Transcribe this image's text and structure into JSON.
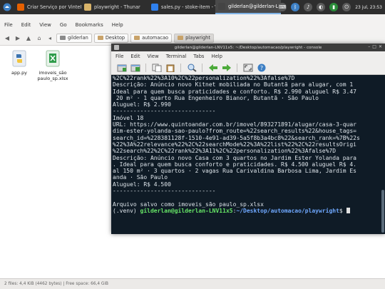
{
  "panel": {
    "tasks": [
      {
        "label": "Criar Serviço por VintePi...",
        "icon": "firefox-icon",
        "color": "#e66000"
      },
      {
        "label": "playwright - Thunar",
        "icon": "folder-icon",
        "color": "#d9b46a"
      },
      {
        "label": "sales.py - stoke-item - VS...",
        "icon": "vscode-icon",
        "color": "#2f80ed"
      },
      {
        "label": "gilderlan@gilderlan-LNV...",
        "icon": "terminal-icon",
        "color": "#444444"
      }
    ],
    "clock": "23 jul, 23:53"
  },
  "file_manager": {
    "menu": [
      "File",
      "Edit",
      "View",
      "Go",
      "Bookmarks",
      "Help"
    ],
    "breadcrumbs": [
      "gilderlan",
      "Desktop",
      "automacao",
      "playwright"
    ],
    "files": [
      {
        "name": "app.py",
        "icon": "python-file-icon"
      },
      {
        "name": "imoveis_são\npaulo_sp.xlsx",
        "icon": "spreadsheet-file-icon"
      }
    ],
    "status": "2 files: 4,4 KiB (4462 bytes) | Free space: 66,4 GiB"
  },
  "terminal": {
    "title": "gilderlan@gilderlan-LNV11x5: ~/Desktop/automacao/playwright - console",
    "menu": [
      "File",
      "Edit",
      "View",
      "Terminal",
      "Tabs",
      "Help"
    ],
    "lines": [
      "%2C%22rank%22%3A10%2C%22personalization%22%3Afalse%7D",
      "Descrição: Anúncio novo Kitnet mobiliada no Butantã para alugar, com 1",
      "Ideal para quem busca praticidades e conforto. R$ 2.990 aluguel R$ 3.47",
      " 20 m² · 1 quarto Rua Engenheiro Bianor, Butantã · São Paulo",
      "Aluguel: R$ 2.990",
      "------------------------------",
      "Imóvel 18",
      "URL: https://www.quintoandar.com.br/imovel/893271891/alugar/casa-3-quar",
      "dim-ester-yolanda-sao-paulo?from_route=%22search_results%22&house_tags=",
      "search_id=%228381128f-1510-4e91-ad39-5a5f8b3a4bc8%22&search_rank=%7B%22s",
      "%22%3A%22relevance%22%2C%22searchMode%22%3A%22list%22%2C%22resultsOrigi",
      "%22search%22%2C%22rank%22%3A11%2C%22personalization%22%3Afalse%7D",
      "Descrição: Anúncio novo Casa com 3 quartos no Jardim Ester Yolanda para",
      ". Ideal para quem busca conforto e praticidades. R$ 4.500 aluguel R$ 4.",
      "al 150 m² · 3 quartos · 2 vagas Rua Carivaldina Barbosa Lima, Jardim Es",
      "anda · São Paulo",
      "Aluguel: R$ 4.500",
      "------------------------------",
      "",
      "Arquivo salvo como imoveis_são paulo_sp.xlsx"
    ],
    "prompt": {
      "venv": "(.venv) ",
      "user": "gilderlan@gilderlan-LNV11x5",
      "sep": ":",
      "path": "~/Desktop/automacao/playwright",
      "dollar": "$ "
    }
  }
}
